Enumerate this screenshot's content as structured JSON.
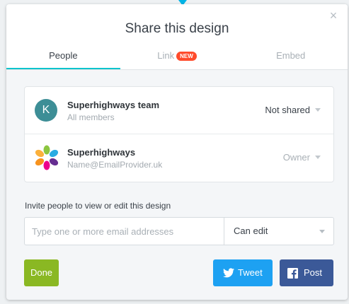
{
  "dialog": {
    "title": "Share this design",
    "close_glyph": "×"
  },
  "tabs": [
    {
      "label": "People",
      "active": true
    },
    {
      "label": "Link",
      "badge": "NEW",
      "active": false
    },
    {
      "label": "Embed",
      "active": false
    }
  ],
  "members": [
    {
      "avatar_letter": "K",
      "name": "Superhighways team",
      "subtitle": "All members",
      "role": "Not shared"
    },
    {
      "avatar": "superhighways-logo",
      "name": "Superhighways",
      "subtitle": "Name@EmailProvider.uk",
      "role": "Owner"
    }
  ],
  "invite": {
    "label": "Invite people to view or edit this design",
    "placeholder": "Type one or more email addresses",
    "permission": "Can edit"
  },
  "buttons": {
    "done": "Done",
    "tweet": "Tweet",
    "post": "Post"
  },
  "colors": {
    "accent_tab": "#00c4cc",
    "badge": "#ff4b2b",
    "done": "#8ab823",
    "twitter": "#1da1f2",
    "facebook": "#3b5998",
    "avatar_k": "#3d8e96"
  }
}
